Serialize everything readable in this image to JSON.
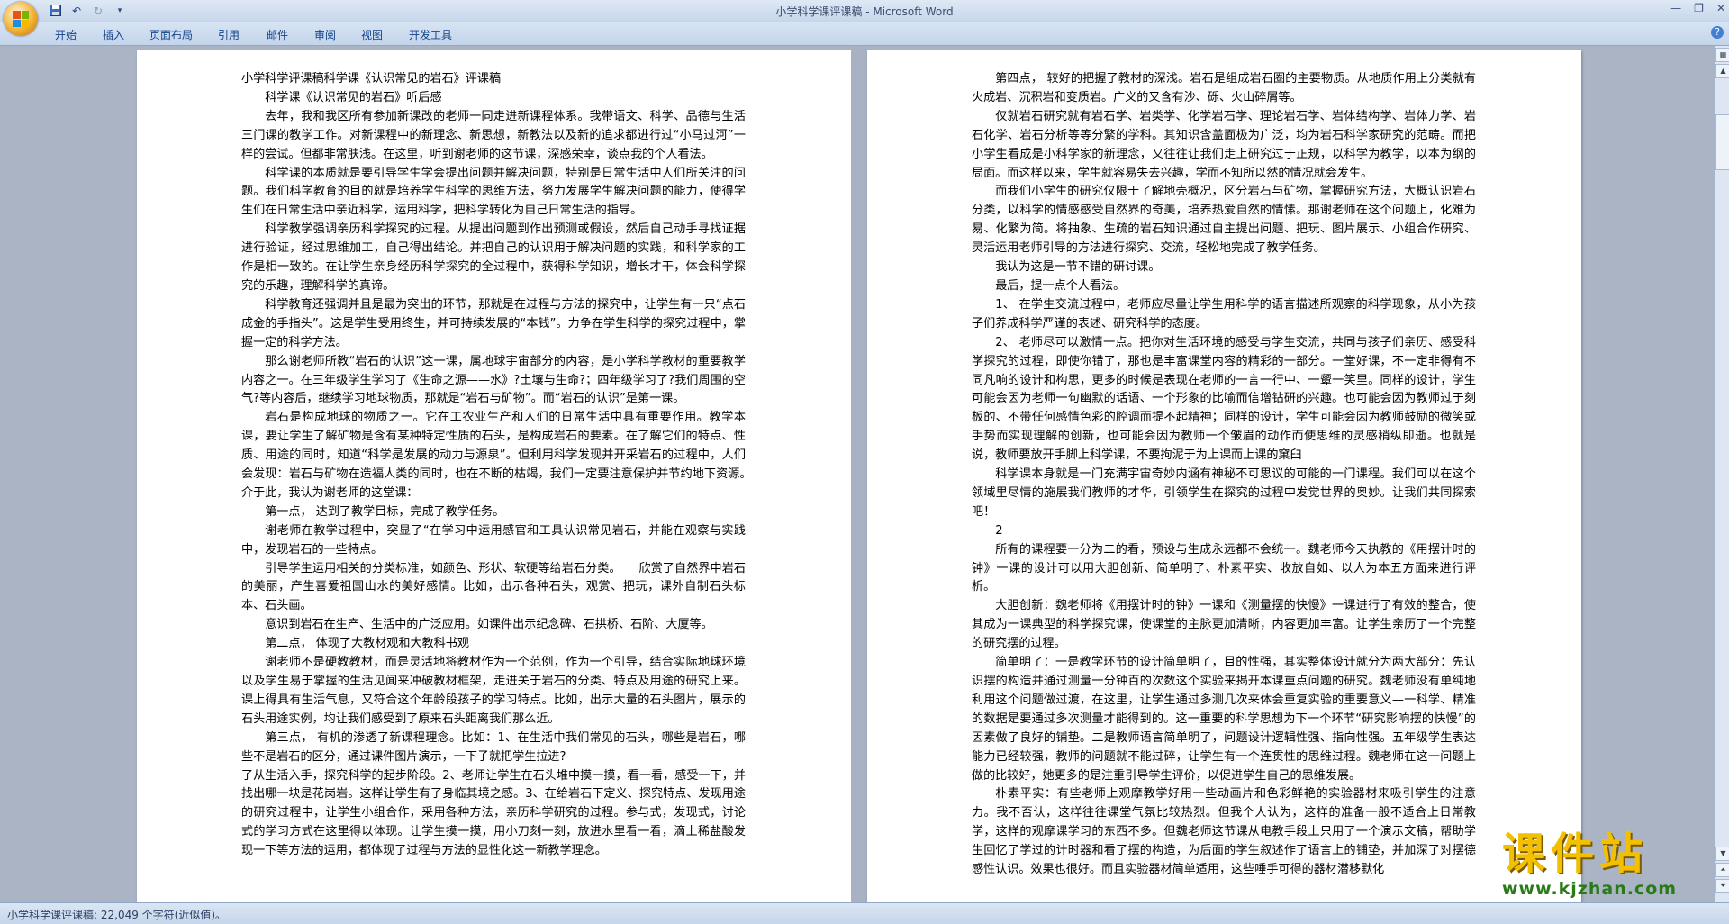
{
  "window": {
    "title": "小学科学课评课稿 - Microsoft Word"
  },
  "qat": {
    "save_icon": "save-icon",
    "undo_icon": "undo-icon",
    "redo_icon": "redo-icon",
    "customize_icon": "chevron-down-icon"
  },
  "ribbon": {
    "tabs": [
      "开始",
      "插入",
      "页面布局",
      "引用",
      "邮件",
      "审阅",
      "视图",
      "开发工具"
    ]
  },
  "document": {
    "left_page": [
      "小学科学评课稿科学课《认识常见的岩石》评课稿",
      "科学课《认识常见的岩石》听后感",
      "去年，我和我区所有参加新课改的老师一同走进新课程体系。我带语文、科学、品德与生活三门课的教学工作。对新课程中的新理念、新思想，新教法以及新的追求都进行过“小马过河”一样的尝试。但都非常肤浅。在这里，听到谢老师的这节课，深感荣幸，谈点我的个人看法。",
      "科学课的本质就是要引导学生学会提出问题并解决问题，特别是日常生活中人们所关注的问题。我们科学教育的目的就是培养学生科学的思维方法，努力发展学生解决问题的能力，使得学生们在日常生活中亲近科学，运用科学，把科学转化为自己日常生活的指导。",
      "科学教学强调亲历科学探究的过程。从提出问题到作出预测或假设，然后自己动手寻找证据进行验证，经过思维加工，自己得出结论。并把自己的认识用于解决问题的实践，和科学家的工作是相一致的。在让学生亲身经历科学探究的全过程中，获得科学知识，增长才干，体会科学探究的乐趣，理解科学的真谛。",
      "科学教育还强调并且是最为突出的环节，那就是在过程与方法的探究中，让学生有一只“点石成金的手指头”。这是学生受用终生，并可持续发展的“本钱”。力争在学生科学的探究过程中，掌握一定的科学方法。",
      "那么谢老师所教“岩石的认识”这一课，属地球宇宙部分的内容，是小学科学教材的重要教学内容之一。在三年级学生学习了《生命之源——水》?土壤与生命?；四年级学习了?我们周围的空气?等内容后，继续学习地球物质，那就是“岩石与矿物”。而“岩石的认识”是第一课。",
      "岩石是构成地球的物质之一。它在工农业生产和人们的日常生活中具有重要作用。教学本课，要让学生了解矿物是含有某种特定性质的石头，是构成岩石的要素。在了解它们的特点、性质、用途的同时，知道“科学是发展的动力与源泉”。但利用科学发现并开采岩石的过程中，人们会发现：岩石与矿物在造福人类的同时，也在不断的枯竭，我们一定要注意保护并节约地下资源。　　介于此，我认为谢老师的这堂课：",
      "第一点，  达到了教学目标，完成了教学任务。",
      "谢老师在教学过程中，突显了“在学习中运用感官和工具认识常见岩石，并能在观察与实践中，发现岩石的一些特点。",
      "引导学生运用相关的分类标准，如颜色、形状、软硬等给岩石分类。　　欣赏了自然界中岩石的美丽，产生喜爱祖国山水的美好感情。比如，出示各种石头，观赏、把玩，课外自制石头标本、石头画。",
      "意识到岩石在生产、生活中的广泛应用。如课件出示纪念碑、石拱桥、石阶、大厦等。",
      "第二点，  体现了大教材观和大教科书观",
      "谢老师不是硬教教材，而是灵活地将教材作为一个范例，作为一个引导，结合实际地球环境以及学生易于掌握的生活见闻来冲破教材框架，走进关于岩石的分类、特点及用途的研究上来。课上得具有生活气息，又符合这个年龄段孩子的学习特点。比如，出示大量的石头图片，展示的石头用途实例，均让我们感受到了原来石头距离我们那么近。",
      "第三点，  有机的渗透了新课程理念。比如：1、在生活中我们常见的石头，哪些是岩石，哪些不是岩石的区分，通过课件图片演示，一下子就把学生拉进?",
      "了从生活入手，探究科学的起步阶段。2、老师让学生在石头堆中摸一摸，看一看，感受一下，并找出哪一块是花岗岩。这样让学生有了身临其境之感。3、在给岩石下定义、探究特点、发现用途的研究过程中，让学生小组合作，采用各种方法，亲历科学研究的过程。参与式，发现式，讨论式的学习方式在这里得以体现。让学生摸一摸，用小刀刻一刻，放进水里看一看，滴上稀盐酸发现一下等方法的运用，都体现了过程与方法的显性化这一新教学理念。"
    ],
    "right_page": [
      "第四点，  较好的把握了教材的深浅。岩石是组成岩石圈的主要物质。从地质作用上分类就有火成岩、沉积岩和变质岩。广义的又含有沙、砾、火山碎屑等。",
      "仅就岩石研究就有岩石学、岩类学、化学岩石学、理论岩石学、岩体结构学、岩体力学、岩石化学、岩石分析等等分繁的学科。其知识含盖面极为广泛，均为岩石科学家研究的范畴。而把小学生看成是小科学家的新理念，又往往让我们走上研究过于正规，以科学为教学，以本为纲的局面。而这样以来，学生就容易失去兴趣，学而不知所以然的情况就会发生。",
      "而我们小学生的研究仅限于了解地壳概况，区分岩石与矿物，掌握研究方法，大概认识岩石分类，以科学的情感感受自然界的奇美，培养热爱自然的情愫。那谢老师在这个问题上，化难为易、化繁为简。将抽象、生疏的岩石知识通过自主提出问题、把玩、图片展示、小组合作研究、灵活运用老师引导的方法进行探究、交流，轻松地完成了教学任务。",
      "我认为这是一节不错的研讨课。",
      "最后，提一点个人看法。",
      "1、  在学生交流过程中，老师应尽量让学生用科学的语言描述所观察的科学现象，从小为孩子们养成科学严谨的表述、研究科学的态度。",
      "2、  老师尽可以激情一点。把你对生活环境的感受与学生交流，共同与孩子们亲历、感受科学探究的过程，即使你错了，那也是丰富课堂内容的精彩的一部分。一堂好课，不一定非得有不同凡响的设计和构思，更多的时候是表现在老师的一言一行中、一颦一笑里。同样的设计，学生可能会因为老师一句幽默的话语、一个形象的比喻而信增钻研的兴趣。也可能会因为教师过于刻板的、不带任何感情色彩的腔调而提不起精神；同样的设计，学生可能会因为教师鼓励的微笑或手势而实现理解的创新，也可能会因为教师一个皱眉的动作而使思维的灵感稍纵即逝。也就是说，教师要放开手脚上科学课，不要拘泥于为上课而上课的窠臼",
      "科学课本身就是一门充满宇宙奇妙内涵有神秘不可思议的可能的一门课程。我们可以在这个领域里尽情的施展我们教师的才华，引领学生在探究的过程中发觉世界的奥妙。让我们共同探索吧！",
      "2",
      "所有的课程要一分为二的看，预设与生成永远都不会统一。魏老师今天执教的《用摆计时的钟》一课的设计可以用大胆创新、简单明了、朴素平实、收放自如、以人为本五方面来进行评析。",
      "大胆创新：魏老师将《用摆计时的钟》一课和《测量摆的快慢》一课进行了有效的整合，使其成为一课典型的科学探究课，使课堂的主脉更加清晰，内容更加丰富。让学生亲历了一个完整的研究摆的过程。",
      "简单明了：一是教学环节的设计简单明了，目的性强，其实整体设计就分为两大部分：先认识摆的构造并通过测量一分钟百的次数这个实验来揭开本课重点问题的研究。魏老师没有单纯地利用这个问题做过渡，在这里，让学生通过多测几次来体会重复实验的重要意义—一科学、精准的数据是要通过多次测量才能得到的。这一重要的科学思想为下一个环节“研究影响摆的快慢”的因素做了良好的铺垫。二是教师语言简单明了，问题设计逻辑性强、指向性强。五年级学生表达能力已经较强，教师的问题就不能过碎，让学生有一个连贯性的思维过程。魏老师在这一问题上做的比较好，她更多的是注重引导学生评价，以促进学生自己的思维发展。",
      "朴素平实：有些老师上观摩教学好用一些动画片和色彩鲜艳的实验器材来吸引学生的注意力。我不否认，这样往往课堂气氛比较热烈。但我个人认为，这样的准备一般不适合上日常教学，这样的观摩课学习的东西不多。但魏老师这节课从电教手段上只用了一个演示文稿，帮助学生回忆了学过的计时器和看了摆的构造，为后面的学生叙述作了语言上的铺垫，并加深了对摆德感性认识。效果也很好。而且实验器材简单适用，这些唾手可得的器材潜移默化"
    ]
  },
  "status": {
    "text": "小学科学课评课稿: 22,049 个字符(近似值)。"
  },
  "watermark": {
    "main": "课件站",
    "url": "www.kjzhan.com"
  }
}
